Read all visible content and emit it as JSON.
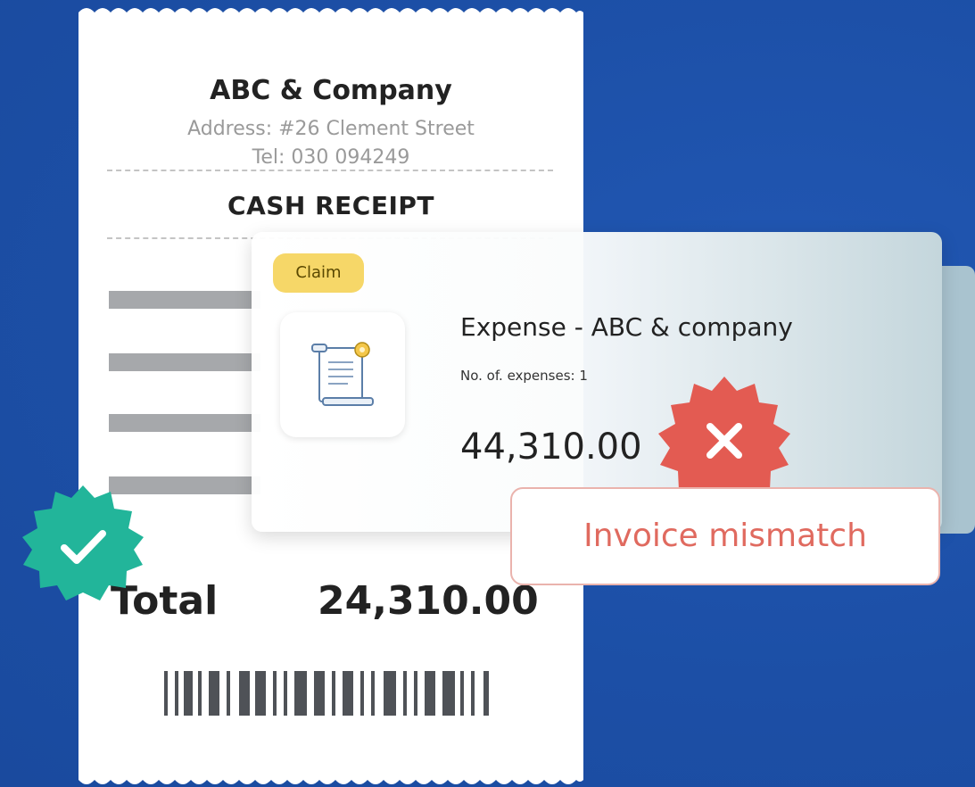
{
  "receipt": {
    "company": "ABC & Company",
    "address": "Address: #26 Clement Street",
    "tel": "Tel: 030 094249",
    "title": "CASH RECEIPT",
    "total_label": "Total",
    "total_value": "24,310.00"
  },
  "claim_card": {
    "badge": "Claim",
    "icon": "document-icon",
    "title": "Expense - ABC & company",
    "subtitle": "No. of. expenses: 1",
    "amount": "44,310.00"
  },
  "status": {
    "mismatch_label": "Invoice mismatch",
    "reject_icon": "close-icon",
    "approve_icon": "check-icon"
  },
  "colors": {
    "background": "#1c4fa6",
    "approve": "#22b59a",
    "reject": "#e35b52",
    "claim_badge": "#f6d768"
  }
}
